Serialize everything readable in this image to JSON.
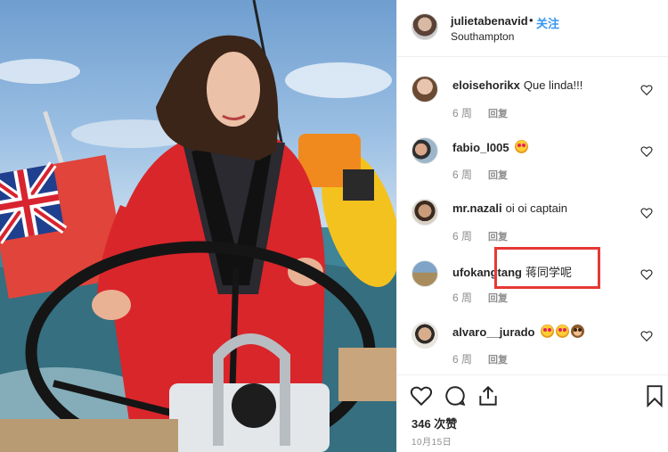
{
  "post": {
    "username": "julietabenavid",
    "separator": "•",
    "follow_label": "关注",
    "location": "Southampton"
  },
  "comments": [
    {
      "user": "eloisehorikx",
      "text": "Que linda!!!",
      "emojis": [],
      "age": "6 周",
      "reply_label": "回复"
    },
    {
      "user": "fabio_l005",
      "text": "",
      "emojis": [
        "heart-eyes-emoji"
      ],
      "age": "6 周",
      "reply_label": "回复"
    },
    {
      "user": "mr.nazali",
      "text": "oi oi captain",
      "emojis": [],
      "age": "6 周",
      "reply_label": "回复"
    },
    {
      "user": "ufokangtang",
      "text": "蒋同学呢",
      "emojis": [],
      "age": "6 周",
      "reply_label": "回复"
    },
    {
      "user": "alvaro__jurado",
      "text": "",
      "emojis": [
        "heart-eyes-emoji",
        "heart-eyes-emoji",
        "see-no-evil-monkey-emoji"
      ],
      "age": "6 周",
      "reply_label": "回复"
    }
  ],
  "actions": {
    "likes": "346 次赞",
    "date": "10月15日"
  },
  "icons": [
    "like-icon",
    "comment-icon",
    "share-icon",
    "bookmark-icon",
    "heart-icon"
  ],
  "colors": {
    "link": "#3897f0",
    "highlight": "#e53935",
    "muted": "#8e8e8e"
  }
}
